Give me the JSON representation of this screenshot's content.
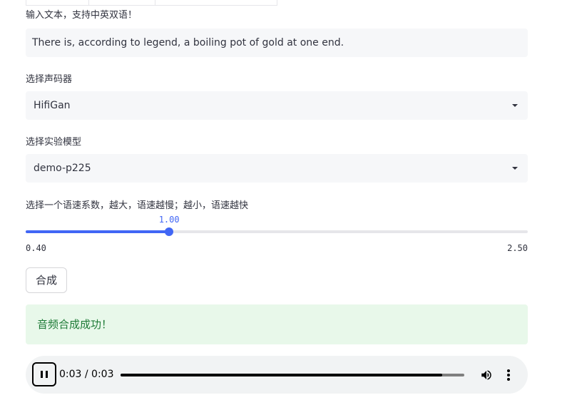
{
  "form": {
    "text_label": "输入文本，支持中英双语！",
    "text_value": "There is, according to legend, a boiling pot of gold at one end.",
    "vocoder_label": "选择声码器",
    "vocoder_value": "HifiGan",
    "model_label": "选择实验模型",
    "model_value": "demo-p225",
    "speed_label": "选择一个语速系数，越大，语速越慢；越小，语速越快",
    "slider": {
      "value": 1.0,
      "value_text": "1.00",
      "min": 0.4,
      "min_text": "0.40",
      "max": 2.5,
      "max_text": "2.50"
    },
    "synth_button": "合成"
  },
  "alert": {
    "success_text": "音频合成成功！"
  },
  "player": {
    "time_text": "0:03 / 0:03",
    "progress": 0.935,
    "icons": {
      "play_pause": "pause-icon",
      "volume": "volume-icon",
      "menu": "more-vert-icon"
    }
  },
  "colors": {
    "accent": "#4166f5",
    "success_bg": "#e8f8ea",
    "success_text": "#1e7b37",
    "input_bg": "#f6f7f9",
    "player_bg": "#f1f3f4"
  }
}
